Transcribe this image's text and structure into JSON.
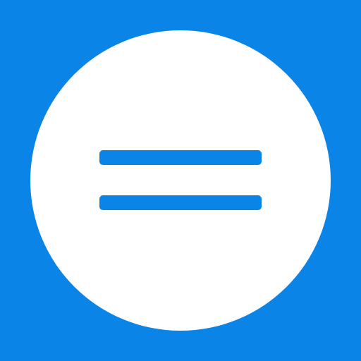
{
  "icon": {
    "name": "equals-icon",
    "background_color": "#0A84E6",
    "circle_color": "#FFFFFF",
    "glyph_color": "#0A84E6"
  }
}
